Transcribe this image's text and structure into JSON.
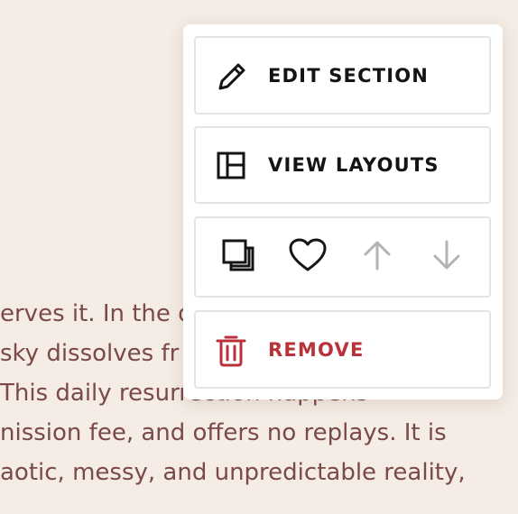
{
  "background_text": {
    "lines": [
      "erves it. In the q",
      "sky dissolves fr",
      "  This daily resurrection happens",
      "nission fee, and offers no replays. It is",
      "aotic, messy, and unpredictable reality,"
    ]
  },
  "menu": {
    "edit_label": "EDIT SECTION",
    "layouts_label": "VIEW LAYOUTS",
    "remove_label": "REMOVE",
    "actions": [
      {
        "name": "duplicate-icon"
      },
      {
        "name": "heart-icon"
      },
      {
        "name": "arrow-up-icon"
      },
      {
        "name": "arrow-down-icon"
      }
    ]
  },
  "colors": {
    "page_background": "#f4ece5",
    "body_text": "#7a4a46",
    "menu_background": "#ffffff",
    "item_border": "#e4e4e4",
    "label": "#141414",
    "danger": "#b8323a",
    "disabled_icon": "#b3b3b3"
  }
}
